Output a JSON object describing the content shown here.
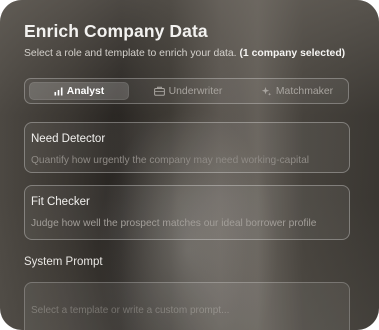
{
  "dialog": {
    "title": "Enrich Company Data",
    "subtitle_prefix": "Select a role and template to enrich your data.",
    "subtitle_selected": "(1 company selected)"
  },
  "tabs": [
    {
      "label": "Analyst",
      "icon": "bar-chart-icon",
      "active": true
    },
    {
      "label": "Underwriter",
      "icon": "briefcase-icon",
      "active": false
    },
    {
      "label": "Matchmaker",
      "icon": "sparkle-icon",
      "active": false
    }
  ],
  "templates": [
    {
      "title": "Need Detector",
      "description": "Quantify how urgently the company may need working-capital"
    },
    {
      "title": "Fit Checker",
      "description": "Judge how well the prospect matches our ideal borrower profile"
    }
  ],
  "system_prompt": {
    "label": "System Prompt",
    "placeholder": "Select a template or write a custom prompt..."
  },
  "colors": {
    "text_primary": "#f3f2f0",
    "text_muted": "#8f8b86",
    "border": "rgba(255,255,255,0.30)"
  }
}
